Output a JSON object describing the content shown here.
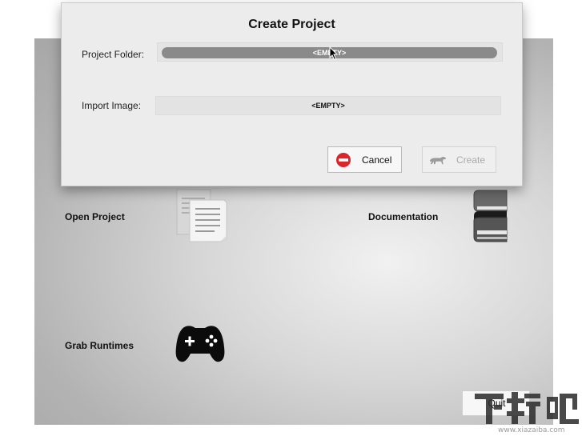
{
  "dialog": {
    "title": "Create Project",
    "project_folder_label": "Project Folder:",
    "project_folder_value": "<EMPTY>",
    "import_image_label": "Import Image:",
    "import_image_value": "<EMPTY>",
    "cancel_label": "Cancel",
    "create_label": "Create"
  },
  "launcher": {
    "open_project_label": "Open Project",
    "documentation_label": "Documentation",
    "grab_runtimes_label": "Grab Runtimes",
    "quit_label": "Quit"
  },
  "watermark": {
    "logo_text": "下载吧",
    "site": "www.xiazaiba.com"
  },
  "icons": {
    "open_project": "documents-icon",
    "documentation": "books-icon",
    "grab_runtimes": "gamepad-icon",
    "cancel": "stop-icon",
    "create": "panther-icon"
  }
}
